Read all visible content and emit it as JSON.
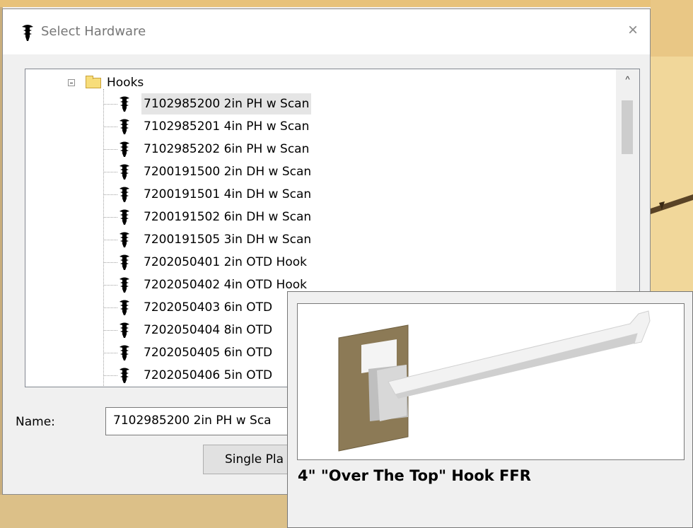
{
  "window": {
    "title": "Select Hardware",
    "close_symbol": "×"
  },
  "tree": {
    "folder": {
      "label": "Hooks",
      "icon": "folder-icon",
      "expanded": true
    },
    "items": [
      {
        "label": "7102985200 2in PH w Scan",
        "selected": true
      },
      {
        "label": "7102985201 4in PH w Scan"
      },
      {
        "label": "7102985202 6in PH w Scan"
      },
      {
        "label": "7200191500 2in DH w Scan"
      },
      {
        "label": "7200191501 4in DH w Scan"
      },
      {
        "label": "7200191502 6in DH w Scan"
      },
      {
        "label": "7200191505 3in DH w Scan"
      },
      {
        "label": "7202050401 2in OTD Hook"
      },
      {
        "label": "7202050402 4in OTD Hook"
      },
      {
        "label": "7202050403 6in OTD"
      },
      {
        "label": "7202050404 8in OTD"
      },
      {
        "label": "7202050405 6in OTD"
      },
      {
        "label": "7202050406 5in OTD"
      }
    ],
    "scroll_up_symbol": "^"
  },
  "form": {
    "name_label": "Name:",
    "name_value": "7102985200 2in PH w Sca",
    "single_button_label": "Single Pla"
  },
  "preview": {
    "caption": "4\" \"Over The Top\" Hook FFR"
  },
  "colors": {
    "board": "#8c7a56",
    "hook": "#f2f2f2",
    "bracket": "#d8d8d8",
    "background_wood": "#e8c27a"
  }
}
